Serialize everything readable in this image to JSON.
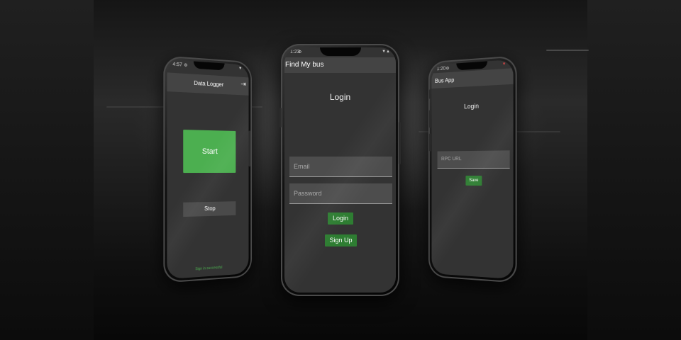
{
  "phones": {
    "left": {
      "status_time": "4:57",
      "appbar_title": "Data Logger",
      "logout_icon": "logout-icon",
      "start_label": "Start",
      "stop_label": "Stop",
      "status_message": "Sign in successful",
      "start_color": "#4caf50",
      "status_color": "#4caf50"
    },
    "center": {
      "status_time": "1:23",
      "appbar_title": "Find My bus",
      "heading": "Login",
      "email_placeholder": "Email",
      "password_placeholder": "Password",
      "login_label": "Login",
      "signup_label": "Sign Up",
      "button_color": "#2e7d32"
    },
    "right": {
      "status_time": "1:20",
      "appbar_title": "Bus App",
      "heading": "Login",
      "rpc_placeholder": "RPC URL",
      "save_label": "Save",
      "button_color": "#2e7d32"
    }
  }
}
